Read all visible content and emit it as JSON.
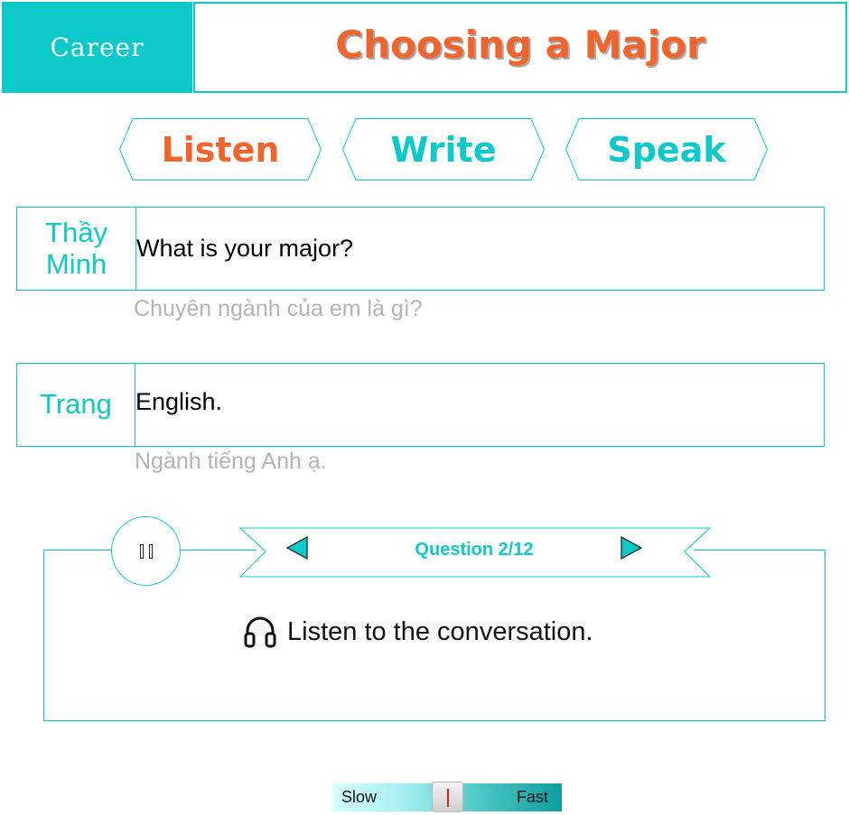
{
  "header": {
    "category": "Career",
    "title": "Choosing a Major"
  },
  "tabs": [
    {
      "label": "Listen",
      "color": "#f0652e",
      "active": true
    },
    {
      "label": "Write",
      "color": "#0ec9c9",
      "active": false
    },
    {
      "label": "Speak",
      "color": "#0ec9c9",
      "active": false
    }
  ],
  "dialogue": [
    {
      "speaker": "Thầy Minh",
      "text": "What is your major?",
      "translation": "Chuyên ngành của em là gì?"
    },
    {
      "speaker": "Trang",
      "text": "English.",
      "translation": "Ngành tiếng Anh ạ."
    }
  ],
  "player": {
    "question_label": "Question 2/12",
    "instruction": "Listen to the conversation.",
    "play_state_icon": "pause-icon",
    "prev_icon": "triangle-left-icon",
    "next_icon": "triangle-right-icon"
  },
  "speed": {
    "slow_label": "Slow",
    "fast_label": "Fast",
    "level": 0.5
  },
  "colors": {
    "accent": "#0ec9c9",
    "title": "#f0652e",
    "translation": "#b4b4b4"
  }
}
